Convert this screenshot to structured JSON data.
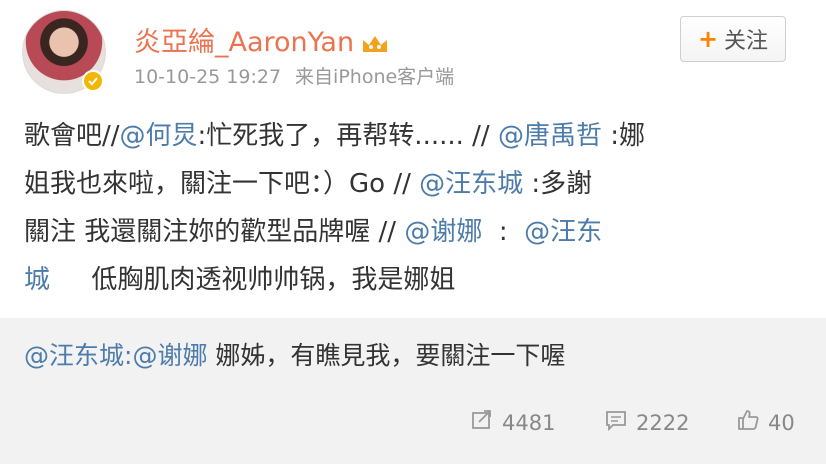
{
  "post": {
    "username": "炎亞綸_AaronYan",
    "timestamp": "10-10-25 19:27",
    "source": "来自iPhone客户端",
    "follow_button": "关注",
    "lines": [
      [
        {
          "t": "歌會吧//"
        },
        {
          "t": "@何炅",
          "m": true
        },
        {
          "t": ":忙死我了，再帮转...... // "
        },
        {
          "t": "@唐禹哲",
          "m": true
        },
        {
          "t": " :娜"
        }
      ],
      [
        {
          "t": "姐我也來啦，關注一下吧：）Go // "
        },
        {
          "t": "@汪东城",
          "m": true
        },
        {
          "t": " :多謝"
        }
      ],
      [
        {
          "t": "關注 我還關注妳的歡型品牌喔 // "
        },
        {
          "t": "@谢娜",
          "m": true
        },
        {
          "t": "  :  "
        },
        {
          "t": "@汪东",
          "m": true
        }
      ],
      [
        {
          "t": "城",
          "m": true
        },
        {
          "t": "     低胸肌肉透视帅帅锅，我是娜姐"
        }
      ]
    ]
  },
  "repost": {
    "author": "@汪东城",
    "sep": ":",
    "mention": "@谢娜",
    "text": " 娜姊，有瞧見我，要關注一下喔"
  },
  "stats": {
    "forward_count": "4481",
    "comment_count": "2222",
    "like_count": "40"
  },
  "icons": {
    "forward": "share-icon",
    "comment": "comment-icon",
    "like": "thumbs-up-icon",
    "vip": "crown-icon",
    "verified": "verified-badge-icon"
  },
  "colors": {
    "username": "#eb7350",
    "mention": "#4d7cab",
    "follow_plus": "#ff8200",
    "repost_bg": "#f2f2f2",
    "meta": "#999999"
  }
}
